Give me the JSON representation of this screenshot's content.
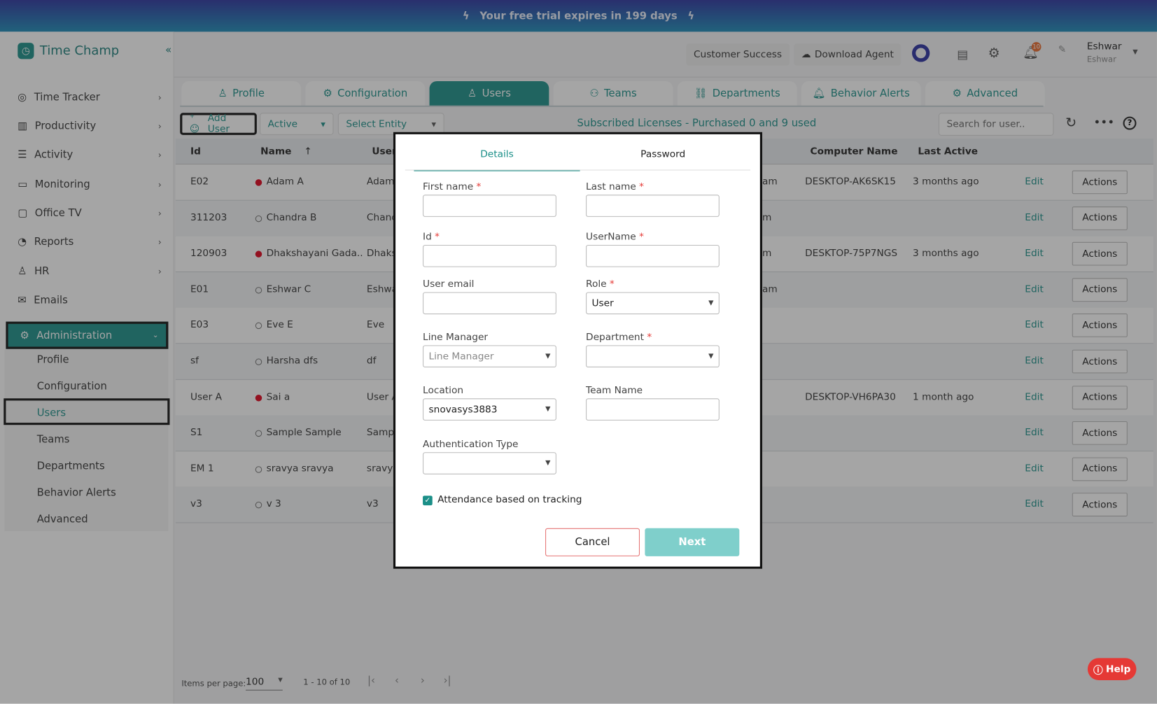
{
  "trial_banner": "Your free trial expires in 199 days",
  "app": {
    "name": "Time Champ"
  },
  "sidebar": {
    "items": [
      {
        "label": "Time Tracker",
        "icon": "stopwatch-icon"
      },
      {
        "label": "Productivity",
        "icon": "chart-icon"
      },
      {
        "label": "Activity",
        "icon": "activity-icon"
      },
      {
        "label": "Monitoring",
        "icon": "monitor-icon"
      },
      {
        "label": "Office TV",
        "icon": "tv-icon"
      },
      {
        "label": "Reports",
        "icon": "pie-icon"
      },
      {
        "label": "HR",
        "icon": "user-icon"
      },
      {
        "label": "Emails",
        "icon": "mail-icon"
      }
    ],
    "admin": "Administration",
    "sub_items": [
      "Profile",
      "Configuration",
      "Users",
      "Teams",
      "Departments",
      "Behavior Alerts",
      "Advanced"
    ]
  },
  "header": {
    "customer_success": "Customer Success",
    "download_agent": "Download Agent",
    "notif_count": "10",
    "user_name": "Eshwar",
    "user_sub": "Eshwar"
  },
  "tabs": [
    "Profile",
    "Configuration",
    "Users",
    "Teams",
    "Departments",
    "Behavior Alerts",
    "Advanced"
  ],
  "toolbar": {
    "add_user": "Add User",
    "status": "Active",
    "entity": "Select Entity",
    "licenses": "Subscribed Licenses - Purchased 0 and 9 used",
    "search_placeholder": "Search for user.."
  },
  "table": {
    "headers": {
      "id": "Id",
      "name": "Name",
      "user": "User",
      "computer": "Computer Name",
      "last_active": "Last Active"
    },
    "rows": [
      {
        "id": "E02",
        "name": "Adam A",
        "online": true,
        "user": "Adam",
        "team": "am",
        "computer": "DESKTOP-AK6SK15",
        "last": "3 months ago"
      },
      {
        "id": "311203",
        "name": "Chandra B",
        "online": false,
        "user": "Chanc",
        "team": "m",
        "computer": "",
        "last": ""
      },
      {
        "id": "120903",
        "name": "Dhakshayani Gada..",
        "online": true,
        "user": "Dhaks",
        "team": "m",
        "computer": "DESKTOP-75P7NGS",
        "last": "3 months ago"
      },
      {
        "id": "E01",
        "name": "Eshwar C",
        "online": false,
        "user": "Eshwa",
        "team": "am",
        "computer": "",
        "last": ""
      },
      {
        "id": "E03",
        "name": "Eve E",
        "online": false,
        "user": "Eve",
        "team": "",
        "computer": "",
        "last": ""
      },
      {
        "id": "sf",
        "name": "Harsha dfs",
        "online": false,
        "user": "df",
        "team": "",
        "computer": "",
        "last": ""
      },
      {
        "id": "User A",
        "name": "Sai a",
        "online": true,
        "user": "User A",
        "team": "",
        "computer": "DESKTOP-VH6PA30",
        "last": "1 month ago"
      },
      {
        "id": "S1",
        "name": "Sample Sample",
        "online": false,
        "user": "Samp",
        "team": "",
        "computer": "",
        "last": ""
      },
      {
        "id": "EM 1",
        "name": "sravya sravya",
        "online": false,
        "user": "sravy",
        "team": "",
        "computer": "",
        "last": ""
      },
      {
        "id": "v3",
        "name": "v 3",
        "online": false,
        "user": "v3",
        "team": "",
        "computer": "",
        "last": ""
      }
    ],
    "edit_label": "Edit",
    "actions_label": "Actions"
  },
  "pagination": {
    "label": "Items per page:",
    "size": "100",
    "range": "1 - 10 of 10"
  },
  "modal": {
    "tabs": [
      "Details",
      "Password"
    ],
    "first_name": "First name",
    "last_name": "Last name",
    "id": "Id",
    "username": "UserName",
    "email": "User email",
    "role": "Role",
    "role_value": "User",
    "line_manager": "Line Manager",
    "line_manager_placeholder": "Line Manager",
    "department": "Department",
    "location": "Location",
    "location_value": "snovasys3883",
    "team_name": "Team Name",
    "auth_type": "Authentication Type",
    "attendance": "Attendance based on tracking",
    "attendance_checked": true,
    "cancel": "Cancel",
    "next": "Next"
  },
  "help": "Help",
  "colors": {
    "brand": "#1b8f88",
    "required": "#e53935"
  }
}
